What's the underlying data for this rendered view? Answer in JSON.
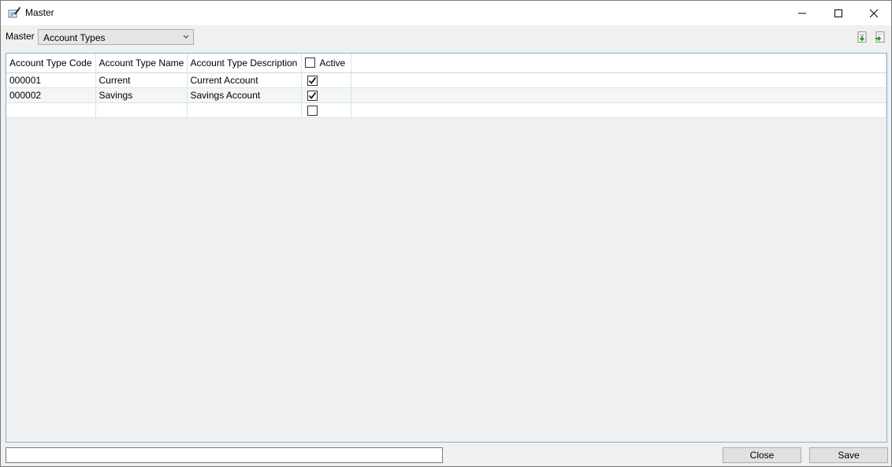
{
  "window": {
    "title": "Master"
  },
  "master": {
    "label": "Master",
    "selected": "Account Types"
  },
  "grid": {
    "columns": [
      "Account Type Code",
      "Account Type Name",
      "Account Type Description",
      "Active"
    ],
    "rows": [
      {
        "code": "000001",
        "name": "Current",
        "description": "Current Account",
        "active": true
      },
      {
        "code": "000002",
        "name": "Savings",
        "description": "Savings Account",
        "active": true
      },
      {
        "code": "",
        "name": "",
        "description": "",
        "active": false
      }
    ]
  },
  "footer": {
    "status_value": "",
    "close_label": "Close",
    "save_label": "Save"
  },
  "colors": {
    "grid_border": "#7fb5d5",
    "window_bg": "#f0f0f0",
    "button_bg": "#e1e1e1"
  }
}
